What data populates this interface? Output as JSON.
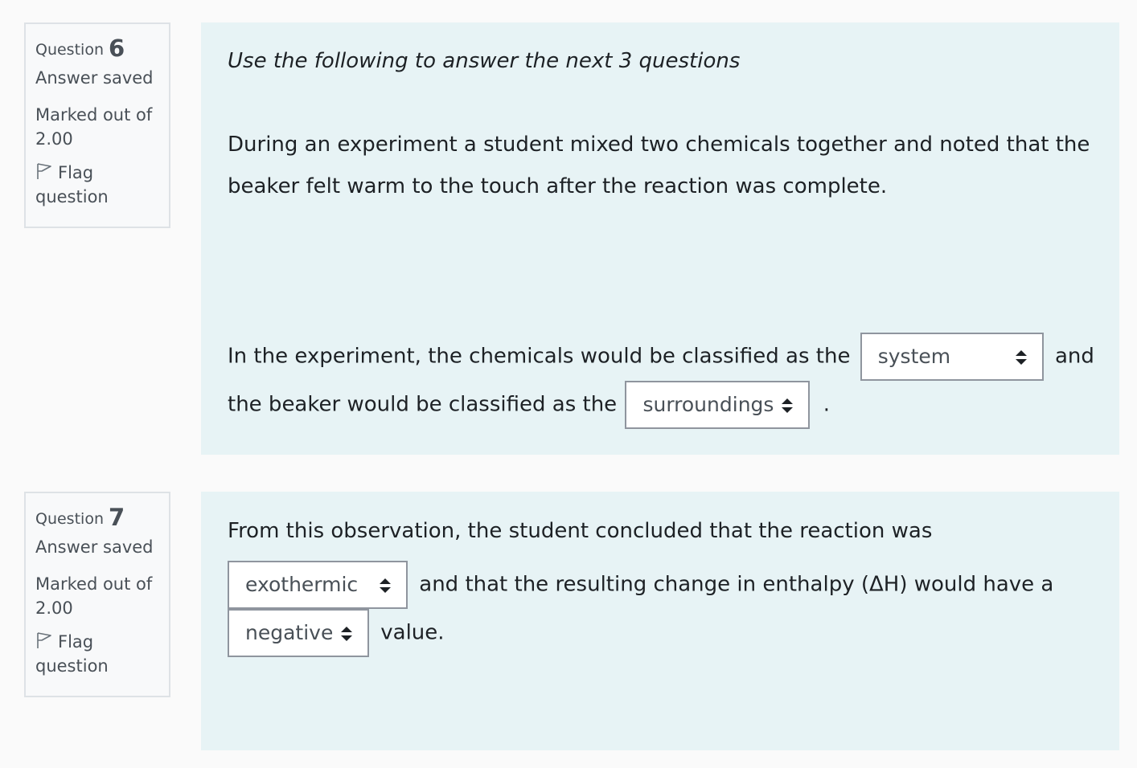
{
  "questions": [
    {
      "label": "Question",
      "number": "6",
      "state": "Answer saved",
      "grade_line1": "Marked out of",
      "grade_line2": "2.00",
      "flag_line1": "Flag",
      "flag_line2": "question",
      "icon": "flag-icon"
    },
    {
      "label": "Question",
      "number": "7",
      "state": "Answer saved",
      "grade_line1": "Marked out of",
      "grade_line2": "2.00",
      "flag_line1": "Flag",
      "flag_line2": "question",
      "icon": "flag-icon"
    }
  ],
  "q6": {
    "intro": "Use the following to answer the next 3 questions",
    "passage_line1": "During an experiment a student mixed two chemicals together and noted that the",
    "passage_line2": "beaker felt warm to the touch after the reaction was complete.",
    "stem_part1": "In the experiment, the chemicals would be classified as the",
    "select1_value": "system",
    "stem_part2": "and",
    "stem_part3": "the beaker would be classified as the",
    "select2_value": "surroundings",
    "stem_part4": "."
  },
  "q7": {
    "stem_line1": "From this observation, the student concluded that the reaction was",
    "select1_value": "exothermic",
    "stem_part2": "and that the resulting change in enthalpy (ΔH) would have a",
    "select2_value": "negative",
    "stem_part3": "value."
  },
  "colors": {
    "page_bg": "#fafafa",
    "content_bg": "#e7f3f5",
    "info_border": "#dee2e6",
    "text": "#1d2125",
    "muted": "#495057"
  }
}
